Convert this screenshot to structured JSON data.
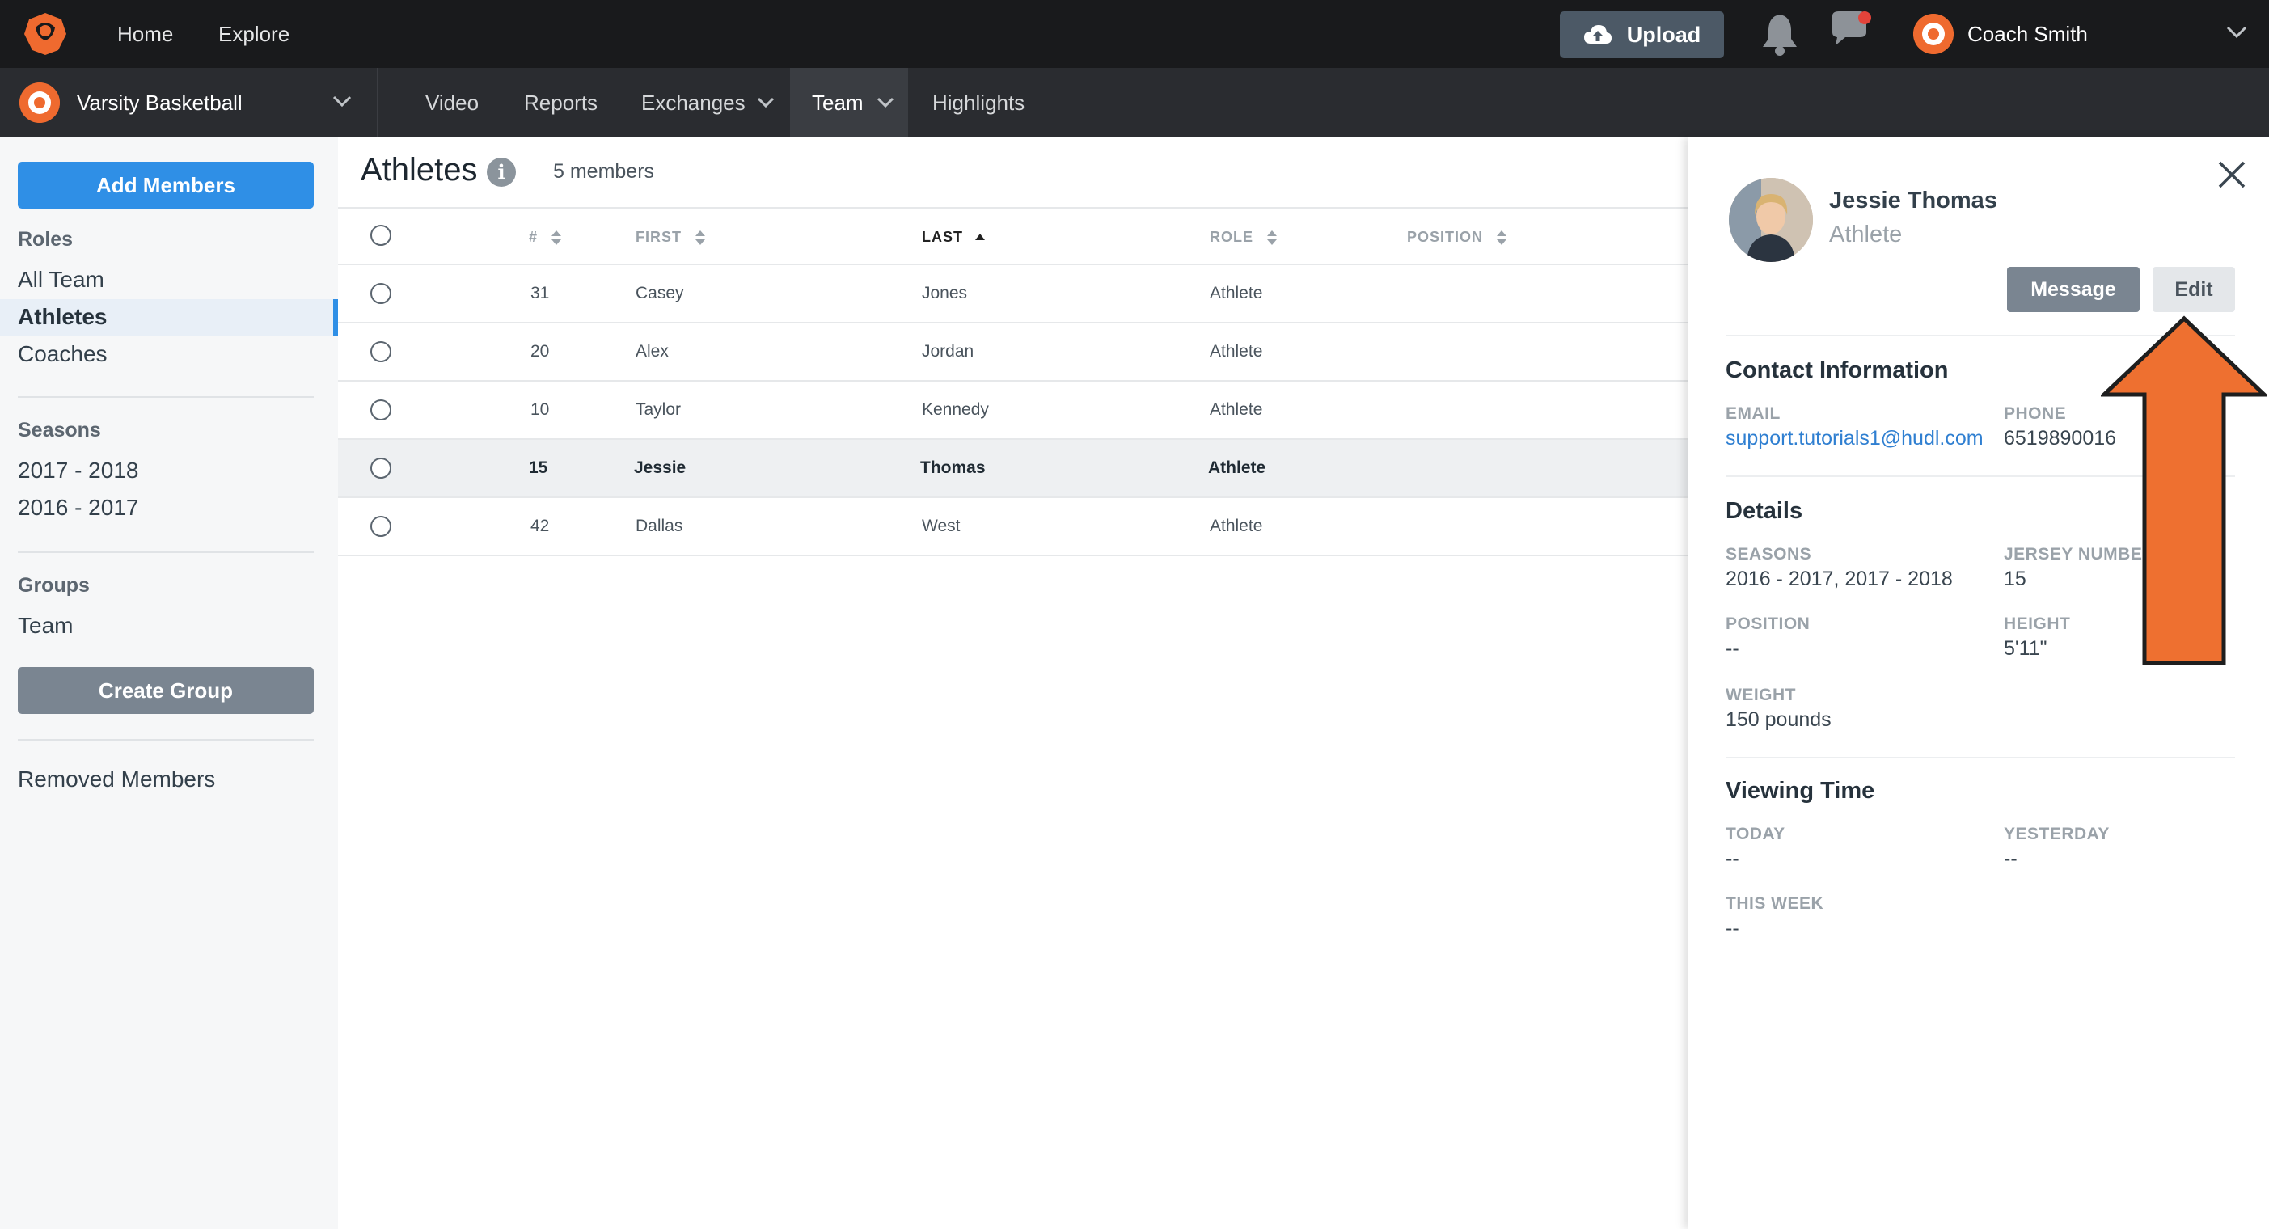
{
  "topbar": {
    "nav": [
      "Home",
      "Explore"
    ],
    "upload_label": "Upload",
    "user_name": "Coach Smith"
  },
  "teambar": {
    "team_name": "Varsity Basketball",
    "nav": [
      "Video",
      "Reports",
      "Exchanges",
      "Team",
      "Highlights"
    ]
  },
  "sidebar": {
    "add_members_label": "Add Members",
    "roles_heading": "Roles",
    "roles": [
      "All Team",
      "Athletes",
      "Coaches"
    ],
    "seasons_heading": "Seasons",
    "seasons": [
      "2017 - 2018",
      "2016 - 2017"
    ],
    "groups_heading": "Groups",
    "groups": [
      "Team"
    ],
    "create_group_label": "Create Group",
    "removed_members_label": "Removed Members"
  },
  "main": {
    "title": "Athletes",
    "info_glyph": "i",
    "member_count": "5 members",
    "columns": [
      "#",
      "FIRST",
      "LAST",
      "ROLE",
      "POSITION"
    ],
    "rows": [
      {
        "num": "31",
        "first": "Casey",
        "last": "Jones",
        "role": "Athlete"
      },
      {
        "num": "20",
        "first": "Alex",
        "last": "Jordan",
        "role": "Athlete"
      },
      {
        "num": "10",
        "first": "Taylor",
        "last": "Kennedy",
        "role": "Athlete"
      },
      {
        "num": "15",
        "first": "Jessie",
        "last": "Thomas",
        "role": "Athlete"
      },
      {
        "num": "42",
        "first": "Dallas",
        "last": "West",
        "role": "Athlete"
      }
    ]
  },
  "panel": {
    "name": "Jessie Thomas",
    "role": "Athlete",
    "message_label": "Message",
    "edit_label": "Edit",
    "contact_heading": "Contact Information",
    "email_label": "EMAIL",
    "email": "support.tutorials1@hudl.com",
    "phone_label": "PHONE",
    "phone": "6519890016",
    "details_heading": "Details",
    "seasons_label": "SEASONS",
    "seasons": "2016 - 2017, 2017 - 2018",
    "jersey_label": "JERSEY NUMBE",
    "jersey": "15",
    "position_label": "POSITION",
    "position": "--",
    "height_label": "HEIGHT",
    "height": "5'11\"",
    "weight_label": "WEIGHT",
    "weight": "150 pounds",
    "viewing_heading": "Viewing Time",
    "today_label": "TODAY",
    "today": "--",
    "yesterday_label": "YESTERDAY",
    "yesterday": "--",
    "week_label": "THIS WEEK",
    "week": "--"
  },
  "colors": {
    "accent_blue": "#2f8fe6",
    "brand_orange": "#ef6a2f",
    "arrow_orange": "#ee7030"
  }
}
